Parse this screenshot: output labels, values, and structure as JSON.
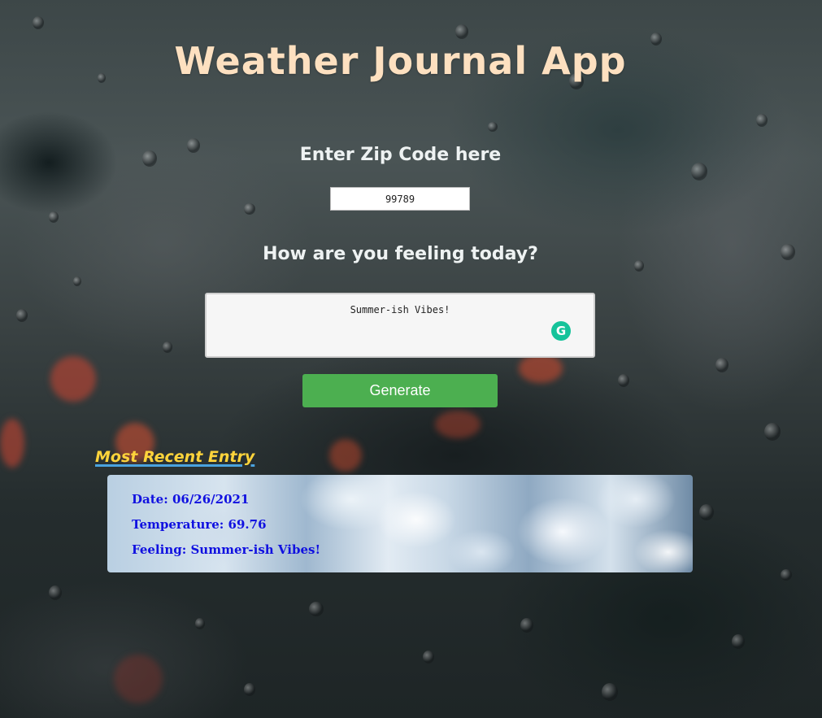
{
  "header": {
    "title": "Weather Journal App"
  },
  "zip": {
    "label": "Enter Zip Code here",
    "value": "99789"
  },
  "feelings": {
    "label": "How are you feeling today?",
    "value": "Summer-ish Vibes!",
    "assist_icon": "grammarly-icon",
    "assist_glyph": "G"
  },
  "actions": {
    "generate_label": "Generate"
  },
  "recent": {
    "heading": "Most Recent Entry",
    "date": "Date: 06/26/2021",
    "temperature": "Temperature: 69.76",
    "feeling": "Feeling: Summer-ish Vibes!"
  },
  "colors": {
    "title": "#fde0c0",
    "heading_accent": "#ffd43b",
    "heading_underline": "#4aa3df",
    "button": "#4caf50",
    "entry_text": "#1010e0"
  }
}
